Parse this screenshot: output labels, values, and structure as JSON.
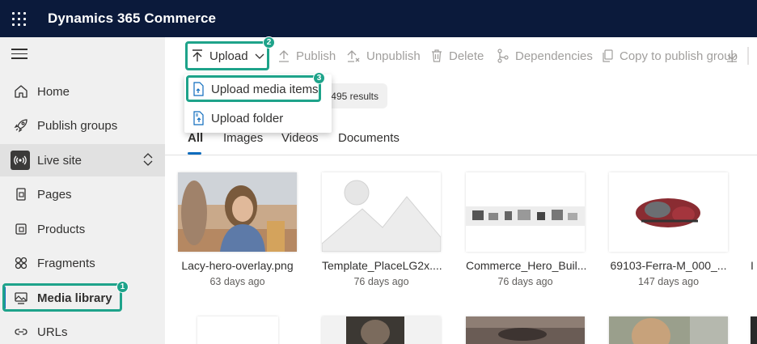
{
  "app": {
    "title": "Dynamics 365 Commerce"
  },
  "sidebar": {
    "items": [
      {
        "label": "Home",
        "icon": "home-icon"
      },
      {
        "label": "Publish groups",
        "icon": "rocket-icon"
      },
      {
        "label": "Live site",
        "icon": "broadcast-icon"
      },
      {
        "label": "Pages",
        "icon": "page-icon"
      },
      {
        "label": "Products",
        "icon": "product-icon"
      },
      {
        "label": "Fragments",
        "icon": "fragments-icon"
      },
      {
        "label": "Media library",
        "icon": "media-library-icon",
        "active": true
      },
      {
        "label": "URLs",
        "icon": "url-icon"
      }
    ]
  },
  "toolbar": {
    "upload": "Upload",
    "publish": "Publish",
    "unpublish": "Unpublish",
    "delete": "Delete",
    "dependencies": "Dependencies",
    "copy_to_publish_group": "Copy to publish group"
  },
  "upload_menu": {
    "items": [
      "Upload media items",
      "Upload folder"
    ]
  },
  "results": "495 results",
  "tabs": [
    "All",
    "Images",
    "Videos",
    "Documents"
  ],
  "media": [
    {
      "name": "Lacy-hero-overlay.png",
      "date": "63 days ago"
    },
    {
      "name": "Template_PlaceLG2x....",
      "date": "76 days ago"
    },
    {
      "name": "Commerce_Hero_Buil...",
      "date": "76 days ago"
    },
    {
      "name": "69103-Ferra-M_000_...",
      "date": "147 days ago"
    }
  ],
  "callouts": [
    "1",
    "2",
    "3"
  ],
  "colors": {
    "header": "#0b1a3b",
    "accent": "#0f6cbd",
    "callout": "#1ea38a"
  }
}
